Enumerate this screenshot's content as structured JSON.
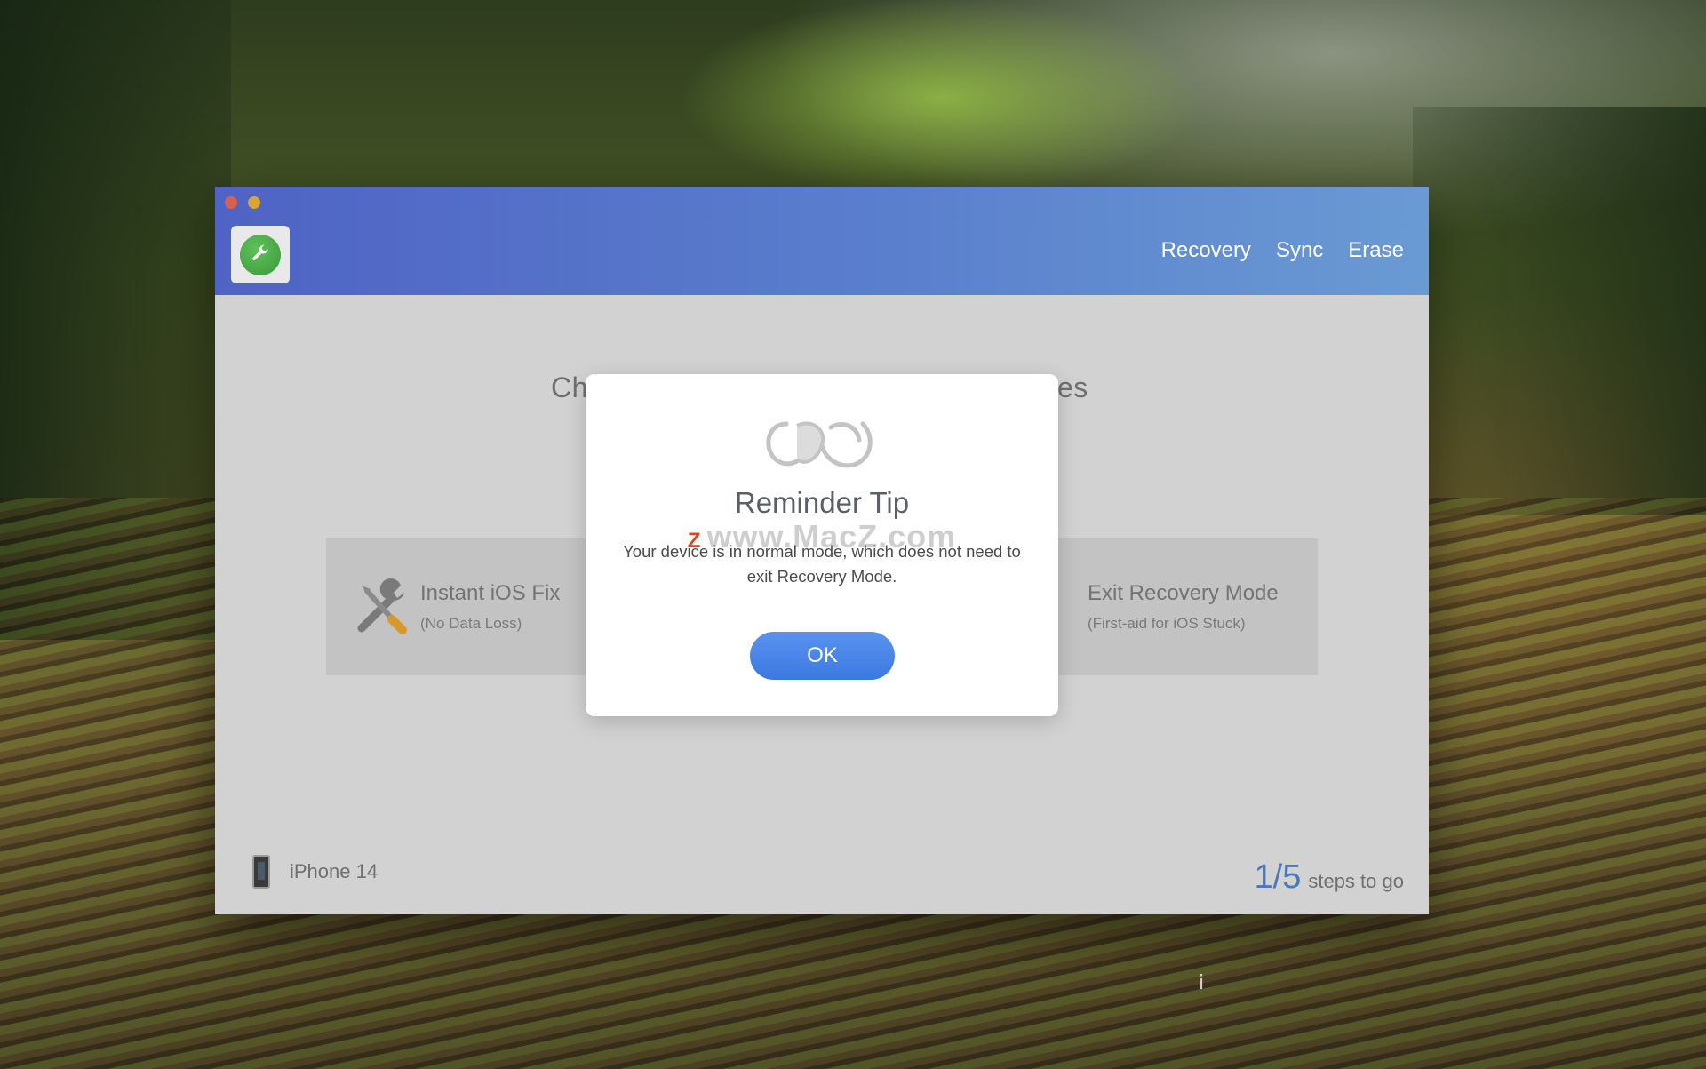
{
  "window": {
    "nav": [
      {
        "label": "Recovery"
      },
      {
        "label": "Sync"
      },
      {
        "label": "Erase"
      }
    ]
  },
  "main": {
    "title_fragment_left": "Ch",
    "title_fragment_right": "es",
    "options": [
      {
        "title": "Instant iOS Fix",
        "subtitle": "(No Data Loss)",
        "icon": "tools-icon"
      },
      {
        "title": "Exit Recovery Mode",
        "subtitle": "(First-aid for iOS Stuck)",
        "icon": "phone-icon"
      }
    ],
    "device_name": "iPhone 14",
    "steps_count": "1/5",
    "steps_label": "steps to go"
  },
  "modal": {
    "title": "Reminder Tip",
    "message": "Your device is in normal mode, which does not need to exit Recovery Mode.",
    "ok_label": "OK",
    "watermark": "www.MacZ.com",
    "watermark_badge": "Z"
  },
  "colors": {
    "titlebar_start": "#4f63c4",
    "titlebar_end": "#6a9ad3",
    "accent": "#3c78e2",
    "steps_color": "#4a78b8"
  }
}
